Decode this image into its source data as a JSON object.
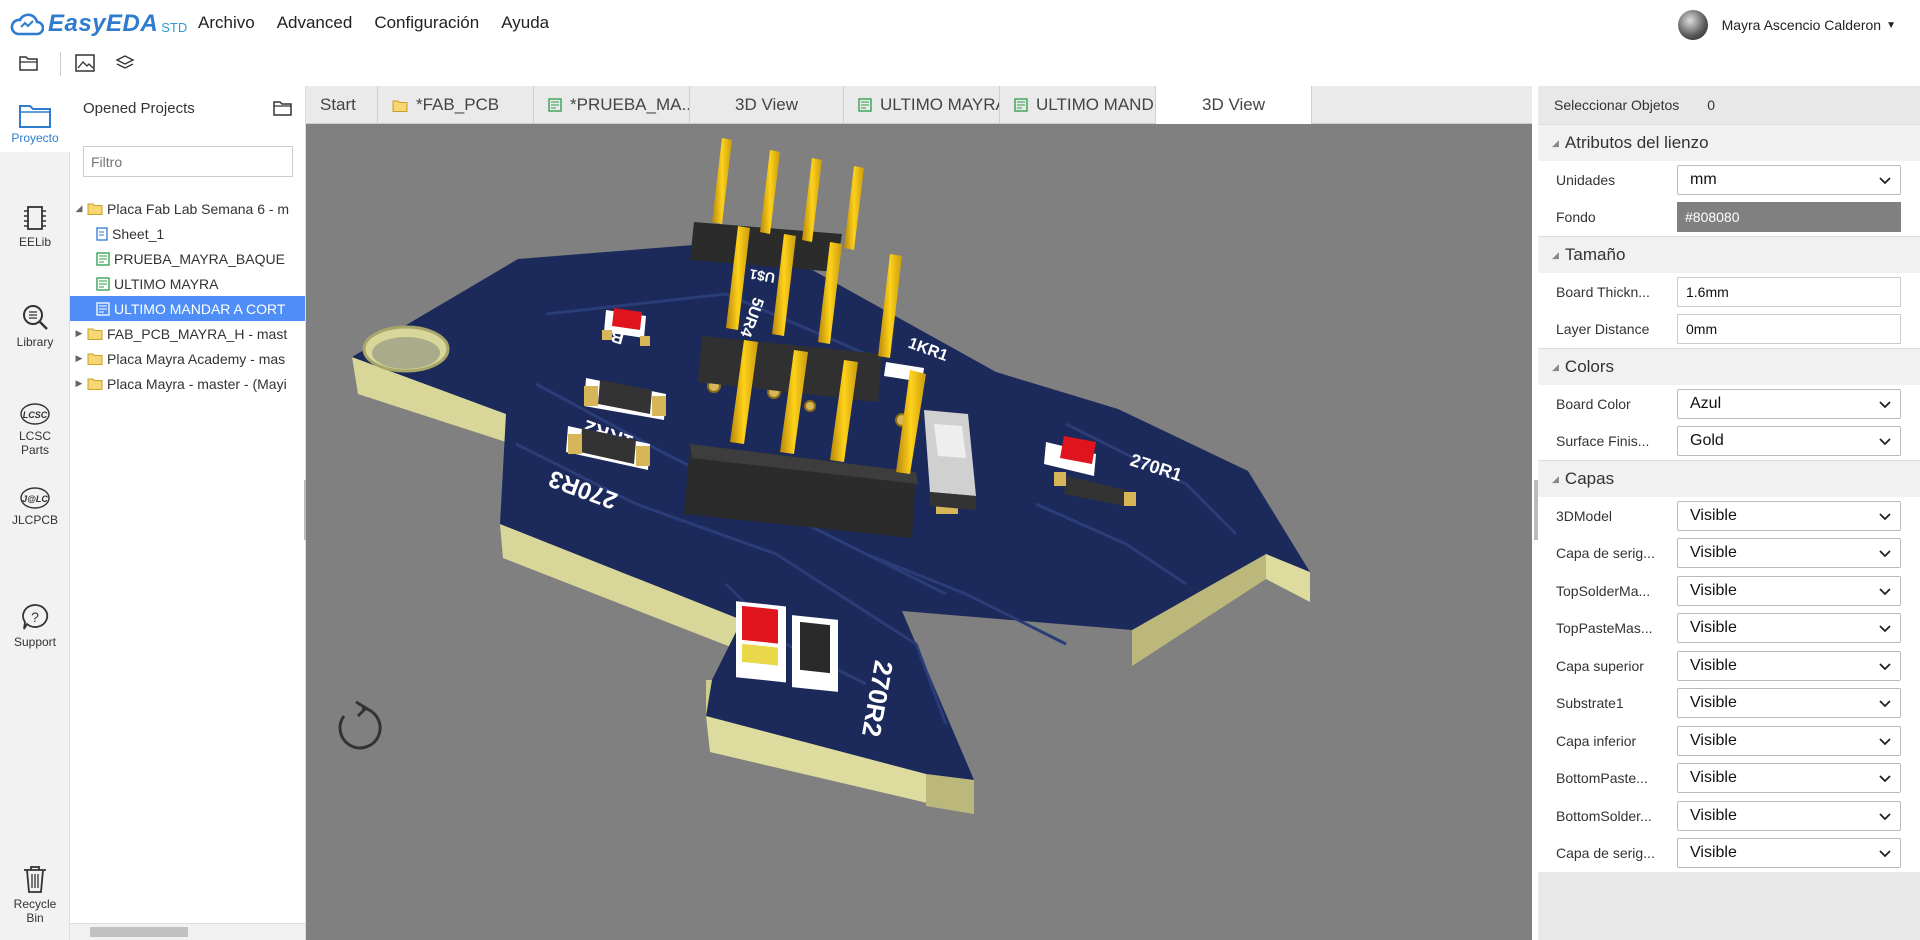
{
  "app": {
    "brand": "EasyEDA",
    "edition": "STD",
    "menu": [
      "Archivo",
      "Advanced",
      "Configuración",
      "Ayuda"
    ],
    "user_name": "Mayra Ascencio Calderon"
  },
  "leftnav": {
    "items": [
      {
        "label": "Proyecto",
        "icon": "folder-icon",
        "active": true
      },
      {
        "label": "EELib",
        "icon": "chip-icon"
      },
      {
        "label": "Library",
        "icon": "search-book-icon"
      },
      {
        "label": "LCSC\nParts",
        "icon": "lcsc-icon",
        "icon_text": "LCSC"
      },
      {
        "label": "JLCPCB",
        "icon": "jlc-icon",
        "icon_text": "J@LC"
      },
      {
        "label": "Support",
        "icon": "help-icon"
      },
      {
        "label": "Recycle\nBin",
        "icon": "trash-icon"
      }
    ]
  },
  "projects": {
    "title": "Opened Projects",
    "filter_placeholder": "Filtro",
    "tree": [
      {
        "label": "Placa Fab Lab Semana 6 - m",
        "type": "folder",
        "level": 0,
        "expanded": true
      },
      {
        "label": "Sheet_1",
        "type": "sheet",
        "level": 1
      },
      {
        "label": "PRUEBA_MAYRA_BAQUE",
        "type": "pcb",
        "level": 1
      },
      {
        "label": "ULTIMO MAYRA",
        "type": "pcb",
        "level": 1
      },
      {
        "label": "ULTIMO MANDAR A CORT",
        "type": "pcb",
        "level": 1,
        "selected": true
      },
      {
        "label": "FAB_PCB_MAYRA_H - mast",
        "type": "folder",
        "level": 0
      },
      {
        "label": "Placa Mayra Academy - mas",
        "type": "folder",
        "level": 0
      },
      {
        "label": "Placa Mayra - master - (Mayi",
        "type": "folder",
        "level": 0
      }
    ]
  },
  "tabs": [
    {
      "label": "Start",
      "icon": ""
    },
    {
      "label": "*FAB_PCB",
      "icon": "folder"
    },
    {
      "label": "*PRUEBA_MA...",
      "icon": "pcb"
    },
    {
      "label": "3D View",
      "icon": "",
      "center": true
    },
    {
      "label": "ULTIMO MAYRA",
      "icon": "pcb"
    },
    {
      "label": "ULTIMO MAND...",
      "icon": "pcb"
    },
    {
      "label": "3D View",
      "icon": "",
      "active": true
    }
  ],
  "viewport": {
    "background": "#808080",
    "silkscreen": [
      "B",
      "5UR4",
      "1KR1",
      "1KR2",
      "270R3",
      "270R1",
      "270R2",
      "U$1"
    ]
  },
  "props": {
    "select_label": "Seleccionar Objetos",
    "select_count": "0",
    "sections": [
      {
        "title": "Atributos del lienzo",
        "rows": [
          {
            "label": "Unidades",
            "kind": "select",
            "value": "mm"
          },
          {
            "label": "Fondo",
            "kind": "color",
            "value": "#808080"
          }
        ]
      },
      {
        "title": "Tamaño",
        "rows": [
          {
            "label": "Board Thickn...",
            "kind": "input",
            "value": "1.6mm"
          },
          {
            "label": "Layer Distance",
            "kind": "input",
            "value": "0mm"
          }
        ]
      },
      {
        "title": "Colors",
        "rows": [
          {
            "label": "Board Color",
            "kind": "select",
            "value": "Azul"
          },
          {
            "label": "Surface Finis...",
            "kind": "select",
            "value": "Gold"
          }
        ]
      },
      {
        "title": "Capas",
        "rows": [
          {
            "label": "3DModel",
            "kind": "select",
            "value": "Visible"
          },
          {
            "label": "Capa de serig...",
            "kind": "select",
            "value": "Visible"
          },
          {
            "label": "TopSolderMa...",
            "kind": "select",
            "value": "Visible"
          },
          {
            "label": "TopPasteMas...",
            "kind": "select",
            "value": "Visible"
          },
          {
            "label": "Capa superior",
            "kind": "select",
            "value": "Visible"
          },
          {
            "label": "Substrate1",
            "kind": "select",
            "value": "Visible"
          },
          {
            "label": "Capa inferior",
            "kind": "select",
            "value": "Visible"
          },
          {
            "label": "BottomPaste...",
            "kind": "select",
            "value": "Visible"
          },
          {
            "label": "BottomSolder...",
            "kind": "select",
            "value": "Visible"
          },
          {
            "label": "Capa de serig...",
            "kind": "select",
            "value": "Visible"
          }
        ]
      }
    ]
  }
}
